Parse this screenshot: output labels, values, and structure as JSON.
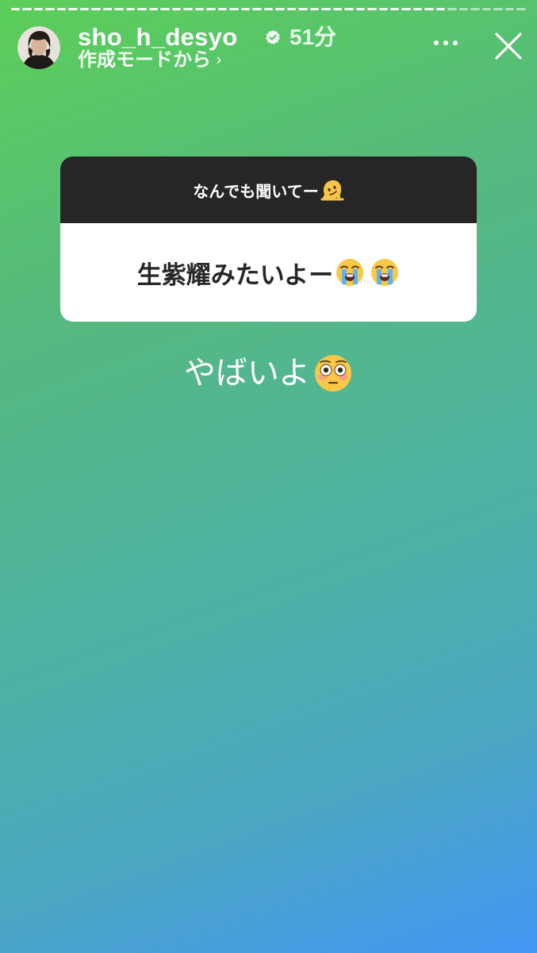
{
  "progress": {
    "segments": 45,
    "completed": 38
  },
  "header": {
    "username": "sho_h_desyo",
    "time": "51分",
    "subline": "作成モードから",
    "subline_chevron": "›"
  },
  "question_sticker": {
    "prompt": "なんでも聞いてー",
    "prompt_emoji": "melting-face",
    "answer": "生紫耀みたいよー",
    "answer_emojis": [
      "loudly-crying-face",
      "loudly-crying-face"
    ]
  },
  "caption": {
    "text": "やばいよ",
    "emoji": "flushed-face"
  },
  "colors": {
    "gradient_top": "#5bcf58",
    "gradient_bottom": "#4396f4",
    "card_header": "#262626",
    "card_body": "#ffffff"
  }
}
